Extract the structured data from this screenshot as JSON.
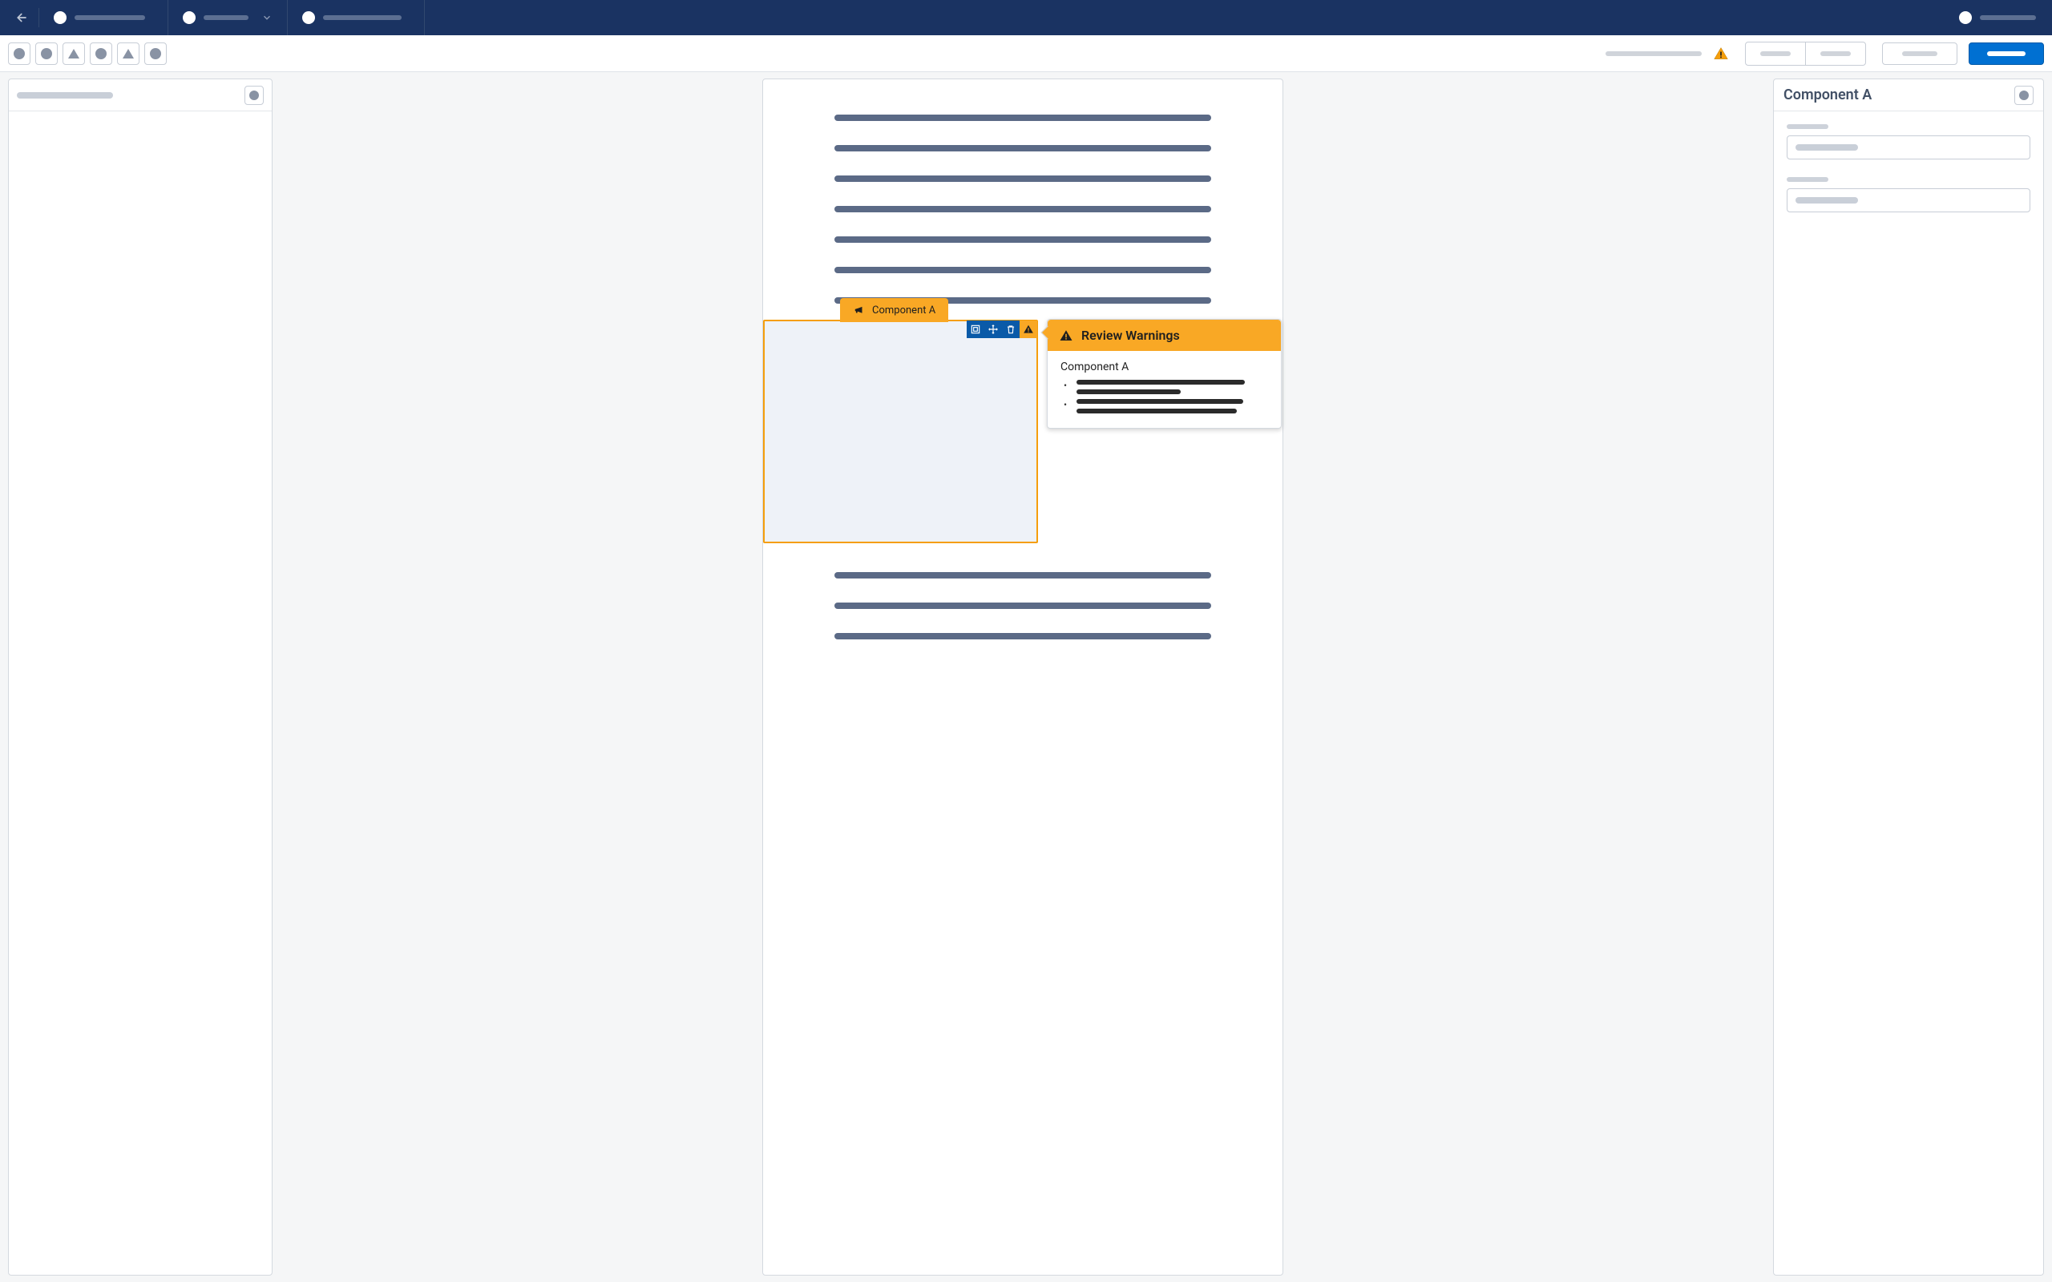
{
  "component_tab_label": "Component A",
  "popover": {
    "header": "Review Warnings",
    "subject": "Component A"
  },
  "right_panel": {
    "title": "Component A"
  }
}
